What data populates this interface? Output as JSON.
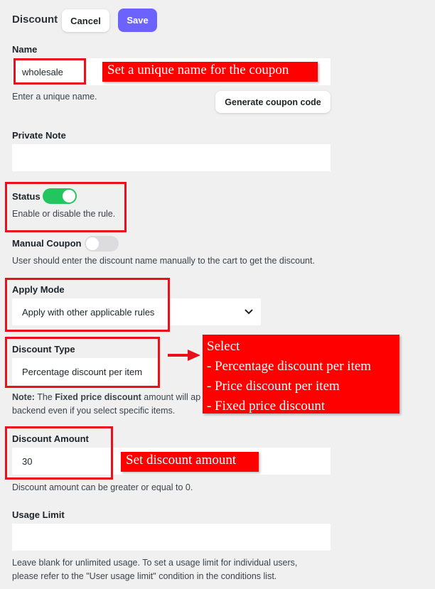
{
  "header": {
    "title": "Discount",
    "cancel_label": "Cancel",
    "save_label": "Save"
  },
  "name": {
    "label": "Name",
    "value": "wholesale",
    "help": "Enter a unique name.",
    "generate_label": "Generate coupon code",
    "callout": "Set a unique name for the coupon"
  },
  "private_note": {
    "label": "Private Note",
    "value": ""
  },
  "status": {
    "label": "Status",
    "enabled": true,
    "help": "Enable or disable the rule."
  },
  "manual_coupon": {
    "label": "Manual Coupon",
    "enabled": false,
    "help": "User should enter the discount name manually to the cart to get the discount."
  },
  "apply_mode": {
    "label": "Apply Mode",
    "value": "Apply with other applicable rules"
  },
  "discount_type": {
    "label": "Discount Type",
    "value": "Percentage discount per item",
    "note_prefix": "Note:",
    "note_the": " The ",
    "note_bold": "Fixed price discount",
    "note_rest": " amount will ap",
    "note_line2": "backend even if you select specific items.",
    "callout_lines": [
      "Select",
      "- Percentage discount per item",
      "- Price discount per item",
      "- Fixed price discount"
    ]
  },
  "discount_amount": {
    "label": "Discount Amount",
    "value": "30",
    "help": "Discount amount can be greater or equal to 0.",
    "callout": "Set discount amount"
  },
  "usage_limit": {
    "label": "Usage Limit",
    "value": "",
    "help_line1": "Leave blank for unlimited usage. To set a usage limit for individual users,",
    "help_line2": "please refer to the \"User usage limit\" condition in the conditions list."
  },
  "colors": {
    "accent": "#6c63ff",
    "toggle_on": "#22c55e",
    "toggle_off": "#dcdcde",
    "annotation_red": "#ff0000"
  }
}
